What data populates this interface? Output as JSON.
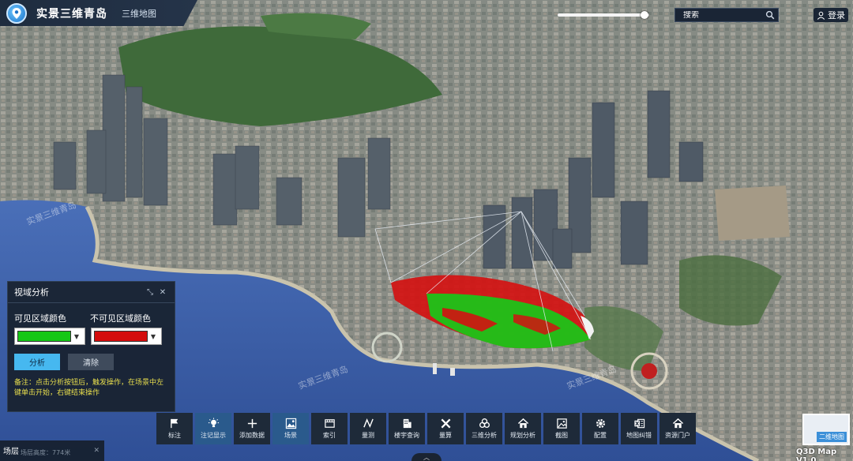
{
  "header": {
    "title": "实景三维青岛",
    "subtitle": "三维地图",
    "logo_icon": "compass-pin-icon"
  },
  "brightness_slider": {
    "level_percent": 95
  },
  "search": {
    "placeholder": "搜索"
  },
  "login": {
    "label": "登录"
  },
  "analysis_panel": {
    "title": "视域分析",
    "visible_label": "可见区域颜色",
    "invisible_label": "不可见区域颜色",
    "visible_color": "#16c716",
    "invisible_color": "#d40d0d",
    "analyze_label": "分析",
    "clear_label": "清除",
    "note": "备注：点击分析按钮后，触发操作，在场景中左键单击开始，右键结束操作"
  },
  "toolbar": {
    "items": [
      {
        "label": "标注",
        "icon": "flag-icon",
        "active": false
      },
      {
        "label": "注记显示",
        "icon": "lightbulb-icon",
        "active": true
      },
      {
        "label": "添加数据",
        "icon": "plus-icon",
        "active": false
      },
      {
        "label": "场景",
        "icon": "scene-icon",
        "active": true
      },
      {
        "label": "索引",
        "icon": "film-icon",
        "active": false
      },
      {
        "label": "量测",
        "icon": "measure-icon",
        "active": false
      },
      {
        "label": "楼宇查询",
        "icon": "building-icon",
        "active": false
      },
      {
        "label": "量算",
        "icon": "tools-icon",
        "active": false
      },
      {
        "label": "三维分析",
        "icon": "cubes-icon",
        "active": false
      },
      {
        "label": "规划分析",
        "icon": "home-icon",
        "active": false
      },
      {
        "label": "截图",
        "icon": "image-icon",
        "active": false
      },
      {
        "label": "配置",
        "icon": "gear-icon",
        "active": false
      },
      {
        "label": "地图纠错",
        "icon": "excel-icon",
        "active": false
      },
      {
        "label": "资源门户",
        "icon": "home-icon",
        "active": false
      }
    ]
  },
  "scene_layer": {
    "label": "场层",
    "value": "场层高度：774米"
  },
  "minimap": {
    "tag": "二维地图"
  },
  "version": "Q3D Map V1.0",
  "watermarks": [
    "实景三维青岛",
    "实景三维青岛",
    "实景三维青岛"
  ],
  "colors": {
    "panel_bg": "#182230",
    "active_blue": "#2a5a8c",
    "analyze_blue": "#46b8f0",
    "sea": "#3a5ea8"
  }
}
